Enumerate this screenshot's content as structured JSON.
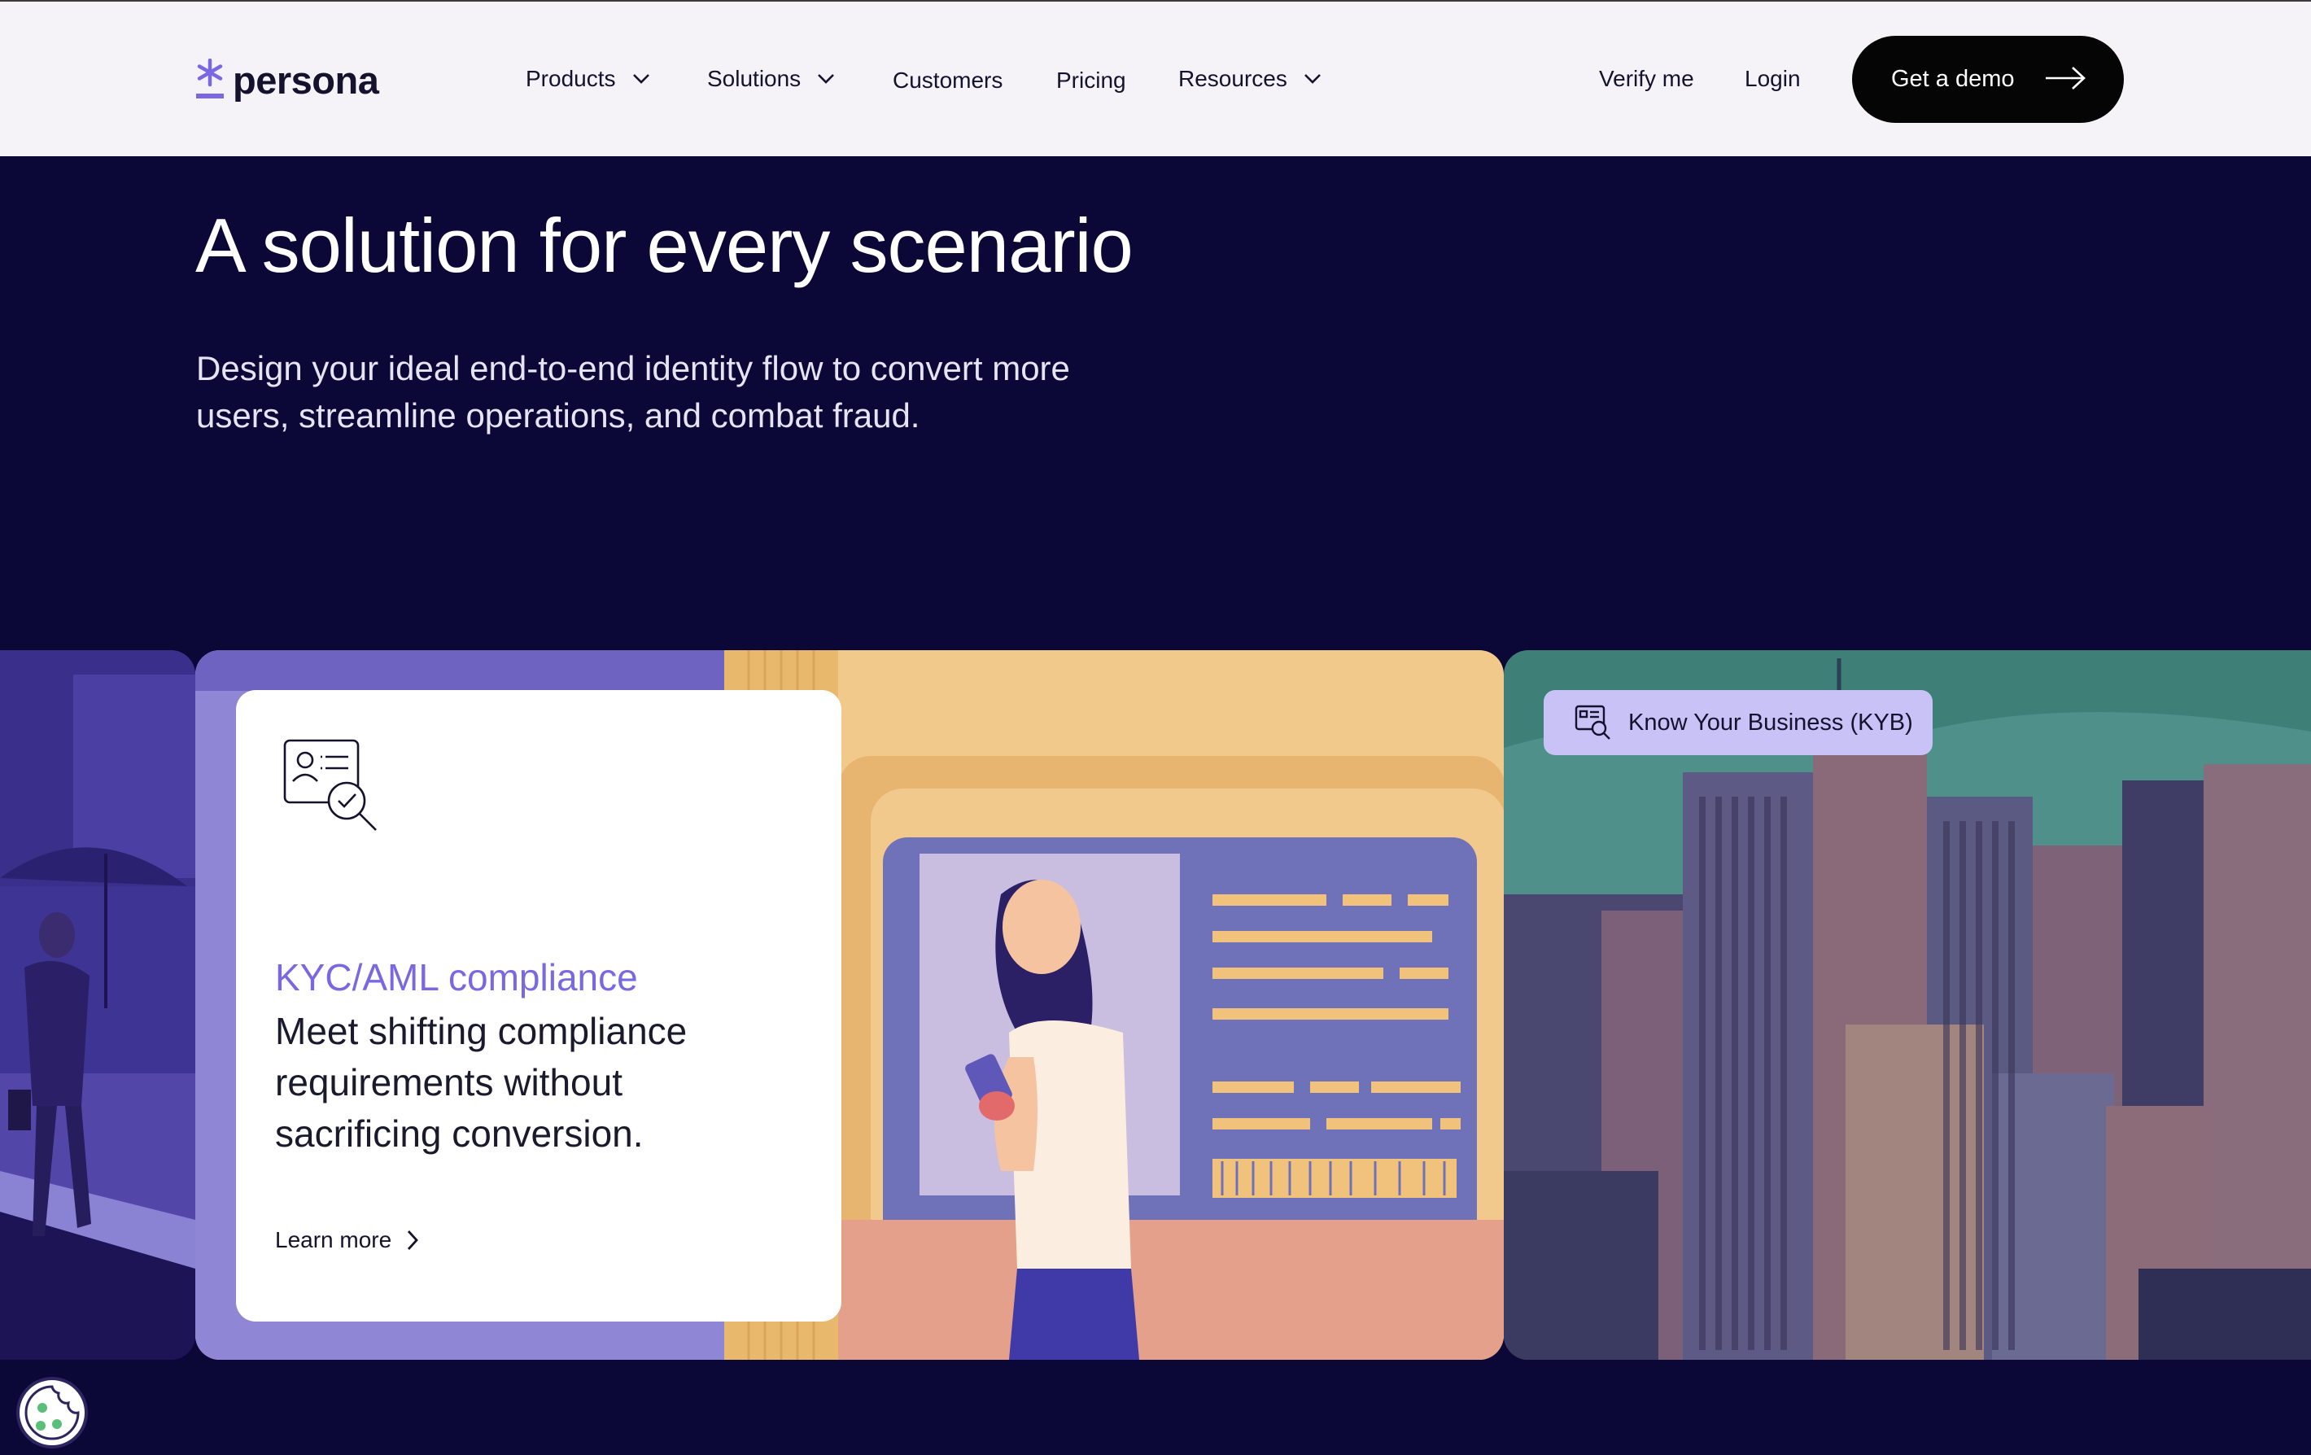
{
  "brand": {
    "name": "persona",
    "accent": "#7a68e3"
  },
  "nav": {
    "items": [
      {
        "label": "Products",
        "has_menu": true
      },
      {
        "label": "Solutions",
        "has_menu": true
      },
      {
        "label": "Customers",
        "has_menu": false
      },
      {
        "label": "Pricing",
        "has_menu": false
      },
      {
        "label": "Resources",
        "has_menu": true
      }
    ],
    "verify_label": "Verify me",
    "login_label": "Login",
    "cta_label": "Get a demo"
  },
  "hero": {
    "title": "A solution for every scenario",
    "subtitle": "Design your ideal end-to-end identity flow to convert more users, streamline operations, and combat fraud."
  },
  "slides": {
    "current": {
      "icon": "id-card-check-icon",
      "kicker": "KYC/AML compliance",
      "body": "Meet shifting compliance requirements without sacrificing conversion.",
      "link_label": "Learn more"
    },
    "next": {
      "icon": "document-search-icon",
      "chip_label": "Know Your Business (KYB)"
    }
  },
  "colors": {
    "page_bg": "#0b0837",
    "nav_bg": "#f5f3f7",
    "cta_bg": "#050505",
    "chip_bg": "#c9c2f7"
  }
}
